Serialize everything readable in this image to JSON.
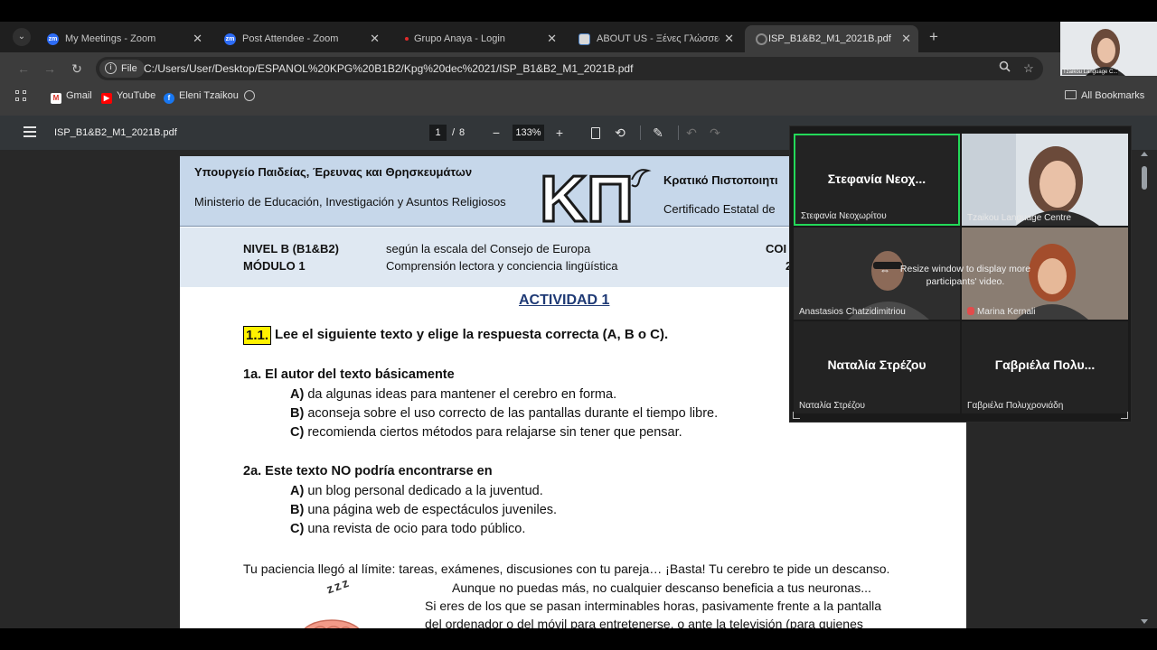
{
  "browser": {
    "tabs": [
      {
        "title": "My Meetings - Zoom",
        "favicon": "zoom-icon",
        "favicon_text": "zm",
        "active": false
      },
      {
        "title": "Post Attendee - Zoom",
        "favicon": "zoom-icon",
        "favicon_text": "zm",
        "active": false
      },
      {
        "title": "Grupo Anaya - Login",
        "favicon": "anaya-icon",
        "favicon_text": "",
        "active": false
      },
      {
        "title": "ABOUT US - Ξένες Γλώσσες Τζα",
        "favicon": "about-icon",
        "favicon_text": "",
        "active": false
      },
      {
        "title": "ISP_B1&B2_M1_2021B.pdf",
        "favicon": "pdf-icon",
        "favicon_text": "",
        "active": true
      }
    ],
    "tab_close_glyph": "✕",
    "new_tab_glyph": "+",
    "address": {
      "chip_label": "File",
      "url": "C:/Users/User/Desktop/ESPANOL%20KPG%20B1B2/Kpg%20dec%2021/ISP_B1&B2_M1_2021B.pdf"
    },
    "bookmarks": [
      {
        "label": "Gmail",
        "icon": "gmail-icon",
        "icon_text": "M"
      },
      {
        "label": "YouTube",
        "icon": "youtube-icon",
        "icon_text": "▶"
      },
      {
        "label": "Eleni Tzaikou",
        "icon": "facebook-icon",
        "icon_text": "f"
      }
    ],
    "all_bookmarks_label": "All Bookmarks"
  },
  "pdf_viewer": {
    "file_name": "ISP_B1&B2_M1_2021B.pdf",
    "current_page": "1",
    "page_separator": "/",
    "total_pages": "8",
    "zoom": "133%"
  },
  "document": {
    "header": {
      "ministry_gr": "Υπουργείο Παιδείας, Έρευνας και Θρησκευμάτων",
      "ministry_es": "Ministerio de Educación, Investigación y Asuntos Religiosos",
      "logo_text": "ΚΠ",
      "certificate_gr": "Κρατικό Πιστοποιητι",
      "certificate_es": "Certificado Estatal de",
      "level": "NIVEL B (B1&B2)",
      "module": "MÓDULO 1",
      "scale": "según la escala del Consejo de Europa",
      "comprehension": "Comprensión lectora y conciencia lingüística",
      "code": "COI",
      "code2": "2"
    },
    "activity_title": "ACTIVIDAD 1",
    "question_number": "1.1.",
    "question_text": "Lee el siguiente texto y elige la respuesta correcta (A, B o C).",
    "questions": [
      {
        "title": "1a. El autor del texto básicamente",
        "options": [
          {
            "letter": "A)",
            "text": "da algunas ideas para mantener el cerebro en forma."
          },
          {
            "letter": "B)",
            "text": "aconseja sobre el uso correcto de las pantallas durante el tiempo libre."
          },
          {
            "letter": "C)",
            "text": "recomienda ciertos métodos para relajarse sin tener que pensar."
          }
        ]
      },
      {
        "title": "2a. Este texto NO podría encontrarse en",
        "options": [
          {
            "letter": "A)",
            "text": "un blog personal dedicado a la juventud."
          },
          {
            "letter": "B)",
            "text": "una página web de espectáculos juveniles."
          },
          {
            "letter": "C)",
            "text": "una revista de ocio para todo público."
          }
        ]
      }
    ],
    "body_lines": [
      "Tu paciencia llegó al límite: tareas, exámenes, discusiones con tu pareja… ¡Basta! Tu cerebro te pide un descanso.",
      "Aunque no puedas más, no cualquier descanso beneficia a tus neuronas...",
      "Si eres de los que se pasan interminables horas, pasivamente frente a la pantalla",
      "del ordenador o del móvil para entretenerse, o ante la televisión (para quienes"
    ],
    "zzz_text": "z z z"
  },
  "zoom": {
    "participants": [
      {
        "display": "Στεφανία Νεοχ...",
        "label": "Στεφανία Νεοχωρίτου",
        "video": false,
        "speaking": true,
        "muted": false
      },
      {
        "display": "",
        "label": "Tzaikou Language Centre",
        "video": true,
        "speaking": false,
        "muted": false
      },
      {
        "display": "",
        "label": "Anastasios Chatzidimitriou",
        "video": true,
        "speaking": false,
        "muted": false
      },
      {
        "display": "",
        "label": "Marina Kernali",
        "video": true,
        "speaking": false,
        "muted": true
      },
      {
        "display": "Ναταλία Στρέζου",
        "label": "Ναταλία Στρέζου",
        "video": false,
        "speaking": false,
        "muted": false
      },
      {
        "display": "Γαβριέλα Πολυ...",
        "label": "Γαβριέλα Πολυχρονιάδη",
        "video": false,
        "speaking": false,
        "muted": false
      }
    ],
    "resize_message": "Resize window to display more participants' video.",
    "self_view_label": "Tzaikou Language C..."
  }
}
